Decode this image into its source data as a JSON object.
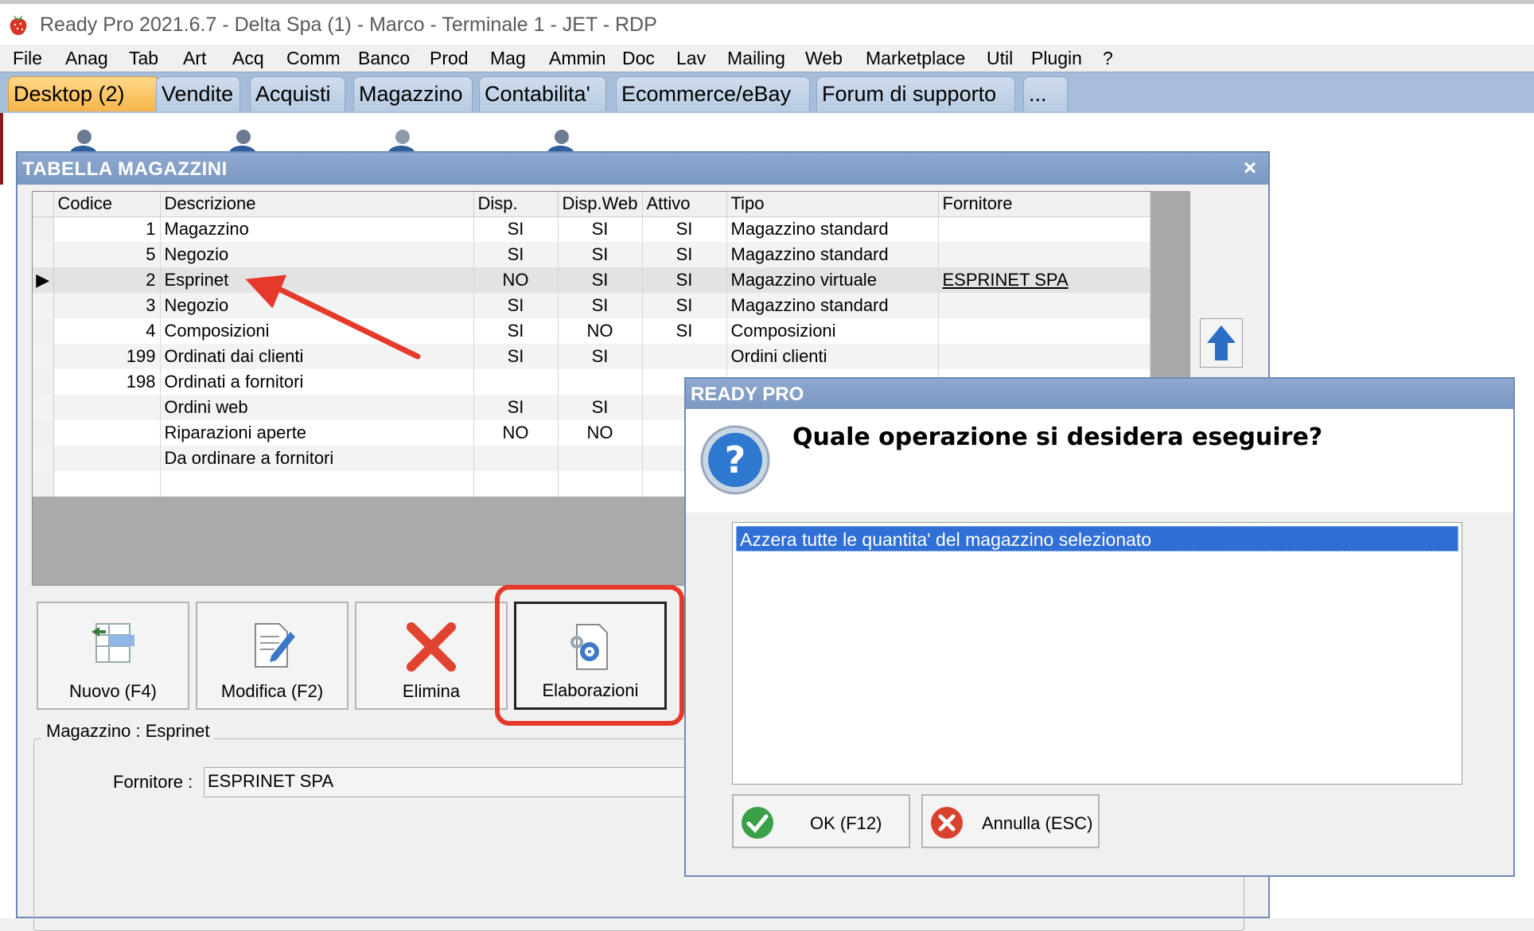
{
  "window": {
    "title": "Ready Pro 2021.6.7 - Delta Spa (1) - Marco - Terminale 1 - JET - RDP"
  },
  "menu": [
    "File",
    "Anag",
    "Tab",
    "Art",
    "Acq",
    "Comm",
    "Banco",
    "Prod",
    "Mag",
    "Ammin",
    "Doc",
    "Lav",
    "Mailing",
    "Web",
    "Marketplace",
    "Util",
    "Plugin",
    "?"
  ],
  "tabs": [
    "Desktop (2)",
    "Vendite",
    "Acquisti",
    "Magazzino",
    "Contabilita'",
    "Ecommerce/eBay",
    "Forum di supporto",
    "..."
  ],
  "main_window": {
    "title": "TABELLA MAGAZZINI",
    "columns": [
      "Codice",
      "Descrizione",
      "Disp.",
      "Disp.Web",
      "Attivo",
      "Tipo",
      "Fornitore"
    ],
    "rows": [
      {
        "codice": "1",
        "descrizione": "Magazzino",
        "disp": "SI",
        "dispweb": "SI",
        "attivo": "SI",
        "tipo": "Magazzino standard",
        "fornitore": ""
      },
      {
        "codice": "5",
        "descrizione": "Negozio",
        "disp": "SI",
        "dispweb": "SI",
        "attivo": "SI",
        "tipo": "Magazzino standard",
        "fornitore": ""
      },
      {
        "codice": "2",
        "descrizione": "Esprinet",
        "disp": "NO",
        "dispweb": "SI",
        "attivo": "SI",
        "tipo": "Magazzino virtuale",
        "fornitore": "ESPRINET SPA"
      },
      {
        "codice": "3",
        "descrizione": "Negozio",
        "disp": "SI",
        "dispweb": "SI",
        "attivo": "SI",
        "tipo": "Magazzino standard",
        "fornitore": ""
      },
      {
        "codice": "4",
        "descrizione": "Composizioni",
        "disp": "SI",
        "dispweb": "NO",
        "attivo": "SI",
        "tipo": "Composizioni",
        "fornitore": ""
      },
      {
        "codice": "199",
        "descrizione": "Ordinati dai clienti",
        "disp": "SI",
        "dispweb": "SI",
        "attivo": "",
        "tipo": "Ordini clienti",
        "fornitore": ""
      },
      {
        "codice": "198",
        "descrizione": "Ordinati a fornitori",
        "disp": "",
        "dispweb": "",
        "attivo": "",
        "tipo": "",
        "fornitore": ""
      },
      {
        "codice": "",
        "descrizione": "Ordini web",
        "disp": "SI",
        "dispweb": "SI",
        "attivo": "",
        "tipo": "",
        "fornitore": ""
      },
      {
        "codice": "",
        "descrizione": "Riparazioni aperte",
        "disp": "NO",
        "dispweb": "NO",
        "attivo": "",
        "tipo": "",
        "fornitore": ""
      },
      {
        "codice": "",
        "descrizione": "Da ordinare a fornitori",
        "disp": "",
        "dispweb": "",
        "attivo": "",
        "tipo": "",
        "fornitore": ""
      },
      {
        "codice": "",
        "descrizione": "",
        "disp": "",
        "dispweb": "",
        "attivo": "",
        "tipo": "",
        "fornitore": ""
      }
    ],
    "selected_row": 2,
    "buttons": {
      "nuovo": "Nuovo (F4)",
      "modifica": "Modifica (F2)",
      "elimina": "Elimina",
      "elaborazioni": "Elaborazioni"
    },
    "group_label": "Magazzino : Esprinet",
    "fornitore_label": "Fornitore :",
    "fornitore_value": "ESPRINET SPA"
  },
  "dialog": {
    "title": "READY PRO",
    "question": "Quale operazione si desidera eseguire?",
    "options": [
      "Azzera tutte le quantita' del magazzino selezionato"
    ],
    "ok_label": "OK (F12)",
    "cancel_label": "Annulla (ESC)"
  },
  "colors": {
    "annotation_red": "#e5392b",
    "window_title": "#7b98c2",
    "selection_blue": "#2f6fd6"
  }
}
